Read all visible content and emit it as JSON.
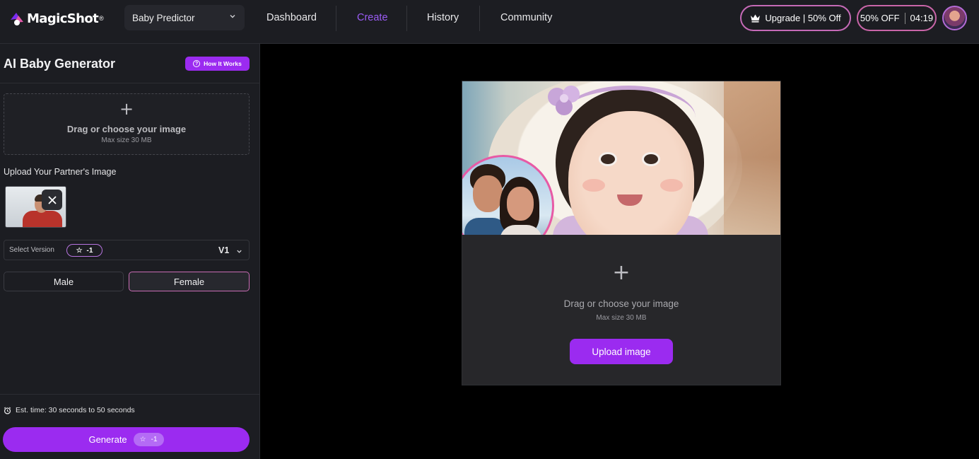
{
  "brand": {
    "name": "MagicShot",
    "reg": "®"
  },
  "tool_select": {
    "value": "Baby Predictor"
  },
  "nav": {
    "dashboard": "Dashboard",
    "create": "Create",
    "history": "History",
    "community": "Community"
  },
  "header": {
    "upgrade_label": "Upgrade | 50% Off",
    "offer_label": "50% OFF",
    "offer_timer": "04:19"
  },
  "panel": {
    "title": "AI Baby Generator",
    "how_it_works": "How It Works",
    "drop_title": "Drag or choose your image",
    "drop_sub": "Max size 30 MB",
    "partner_label": "Upload Your Partner's Image",
    "version_label": "Select Version",
    "version_cost": "-1",
    "version_value": "V1",
    "gender_male": "Male",
    "gender_female": "Female",
    "gender_selected": "Female",
    "est_time": "Est. time: 30 seconds to 50 seconds",
    "generate_label": "Generate",
    "generate_cost": "-1"
  },
  "main": {
    "drop_title": "Drag or choose your image",
    "drop_sub": "Max size 30 MB",
    "upload_button": "Upload image"
  },
  "colors": {
    "accent": "#9b2bf0",
    "nav_active": "#9b5cf5",
    "panel_bg": "#1c1d22",
    "card_bg": "#27272a"
  }
}
